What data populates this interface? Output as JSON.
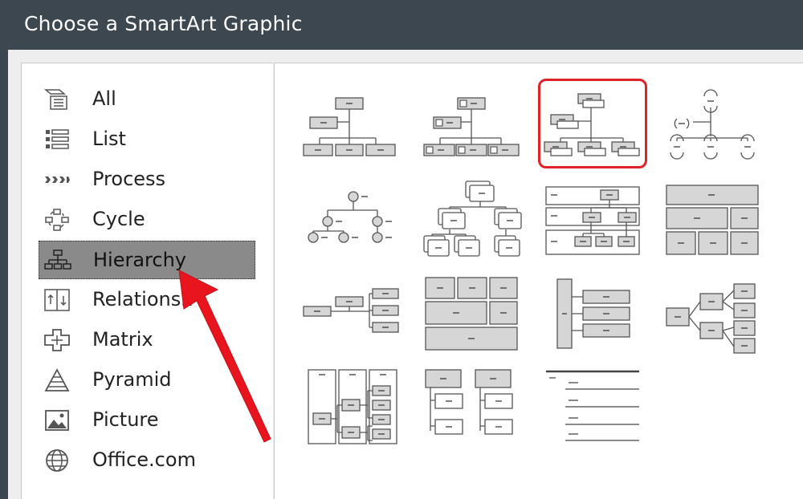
{
  "dialog": {
    "title": "Choose a SmartArt Graphic"
  },
  "categories": [
    {
      "label": "All",
      "icon": "all-icon"
    },
    {
      "label": "List",
      "icon": "list-icon"
    },
    {
      "label": "Process",
      "icon": "process-icon"
    },
    {
      "label": "Cycle",
      "icon": "cycle-icon"
    },
    {
      "label": "Hierarchy",
      "icon": "hierarchy-icon",
      "selected": true
    },
    {
      "label": "Relationsh",
      "icon": "relationship-icon"
    },
    {
      "label": "Matrix",
      "icon": "matrix-icon"
    },
    {
      "label": "Pyramid",
      "icon": "pyramid-icon"
    },
    {
      "label": "Picture",
      "icon": "picture-icon"
    },
    {
      "label": "Office.com",
      "icon": "globe-icon"
    }
  ],
  "layouts": {
    "count": 15,
    "highlighted_index": 2,
    "highlight_color": "#e0222b"
  },
  "colors": {
    "titlebar": "#3c4750",
    "selection": "#8a8a8a",
    "shape_fill": "#d6d6d6",
    "shape_stroke": "#555555",
    "annotation_arrow": "#e8151f"
  }
}
